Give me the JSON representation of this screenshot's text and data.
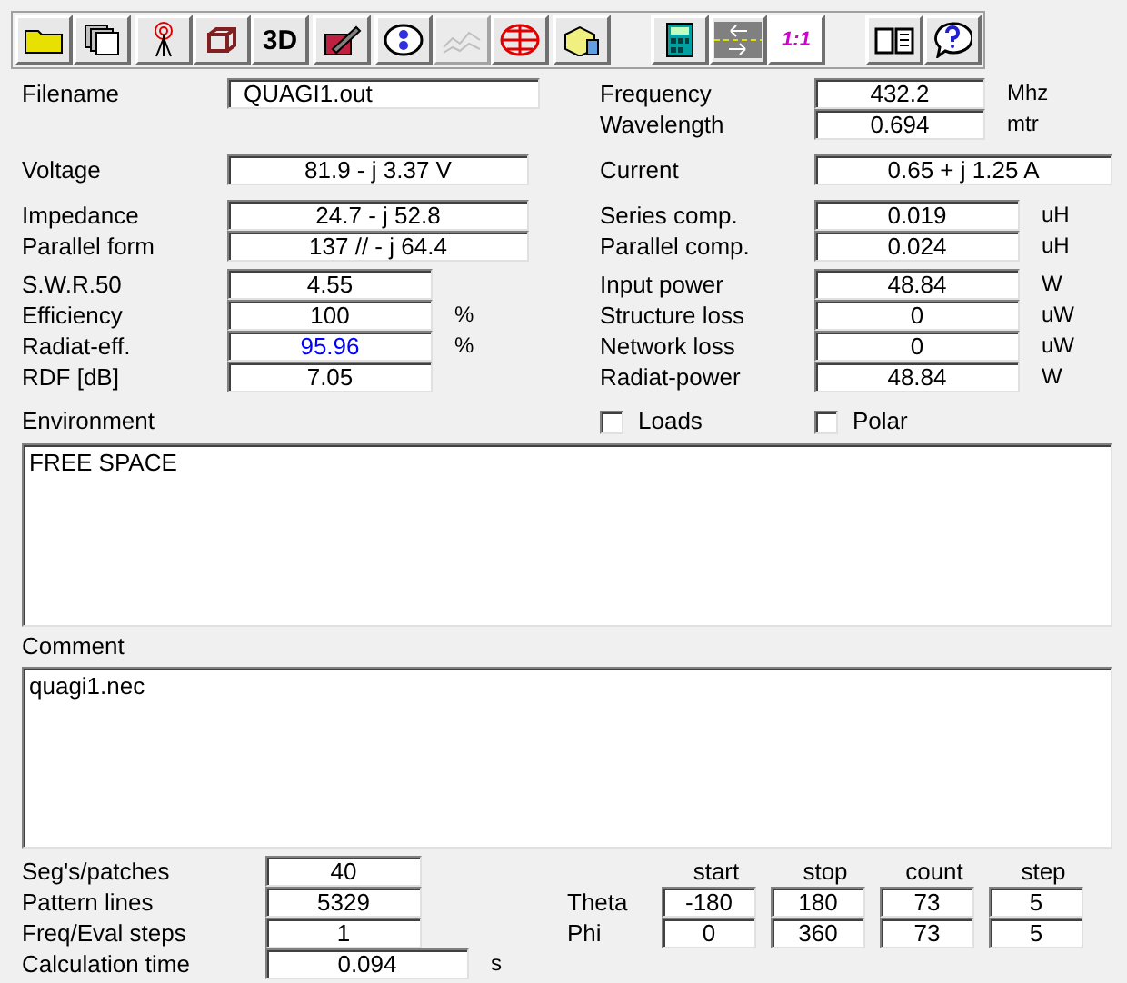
{
  "toolbar": [
    {
      "disabled": false
    },
    {
      "disabled": false
    },
    {
      "disabled": false
    },
    {
      "disabled": false
    },
    {
      "label": "3D",
      "disabled": false
    },
    {
      "disabled": false
    },
    {
      "disabled": false
    },
    {
      "disabled": true
    },
    {
      "disabled": false
    },
    {
      "disabled": false
    },
    {
      "disabled": false
    },
    {
      "disabled": false
    },
    {
      "label": "1:1",
      "disabled": false
    },
    {
      "disabled": false
    },
    {
      "disabled": false
    }
  ],
  "filename": {
    "label": "Filename",
    "value": "QUAGI1.out"
  },
  "frequency": {
    "label": "Frequency",
    "value": "432.2",
    "unit": "Mhz"
  },
  "wavelength": {
    "label": "Wavelength",
    "value": "0.694",
    "unit": "mtr"
  },
  "voltage": {
    "label": "Voltage",
    "value": "81.9 - j 3.37 V"
  },
  "current": {
    "label": "Current",
    "value": "0.65 + j 1.25 A"
  },
  "left_params": [
    {
      "label": "Impedance",
      "value": "24.7 - j 52.8",
      "kind": "wide",
      "highlighted": false
    },
    {
      "label": "Parallel form",
      "value": "137 // - j 64.4",
      "kind": "wide",
      "highlighted": false
    },
    {
      "label": "S.W.R.50",
      "value": "4.55",
      "kind": "short",
      "highlighted": false
    },
    {
      "label": "Efficiency",
      "value": "100",
      "unit": "%",
      "kind": "short",
      "highlighted": false
    },
    {
      "label": "Radiat-eff.",
      "value": "95.96",
      "unit": "%",
      "kind": "short",
      "highlighted": true
    },
    {
      "label": "RDF [dB]",
      "value": "7.05",
      "kind": "short",
      "highlighted": false
    }
  ],
  "right_params": [
    {
      "label": "Series comp.",
      "value": "0.019",
      "unit": "uH"
    },
    {
      "label": "Parallel comp.",
      "value": "0.024",
      "unit": "uH"
    },
    {
      "label": "Input power",
      "value": "48.84",
      "unit": "W"
    },
    {
      "label": "Structure loss",
      "value": "0",
      "unit": "uW"
    },
    {
      "label": "Network loss",
      "value": "0",
      "unit": "uW"
    },
    {
      "label": "Radiat-power",
      "value": "48.84",
      "unit": "W"
    }
  ],
  "environment": {
    "label": "Environment",
    "value": "FREE SPACE"
  },
  "options": [
    {
      "label": "Loads",
      "checked": false
    },
    {
      "label": "Polar",
      "checked": false
    }
  ],
  "comment": {
    "label": "Comment",
    "value": "quagi1.nec"
  },
  "run_params": [
    {
      "label": "Seg's/patches",
      "value": "40"
    },
    {
      "label": "Pattern lines",
      "value": "5329"
    },
    {
      "label": "Freq/Eval steps",
      "value": "1"
    },
    {
      "label": "Calculation time",
      "value": "0.094",
      "unit": "s"
    }
  ],
  "pattern": {
    "columns": [
      "start",
      "stop",
      "count",
      "step"
    ],
    "rows": [
      {
        "label": "Theta",
        "values": [
          "-180",
          "180",
          "73",
          "5"
        ]
      },
      {
        "label": "Phi",
        "values": [
          "0",
          "360",
          "73",
          "5"
        ]
      }
    ]
  }
}
